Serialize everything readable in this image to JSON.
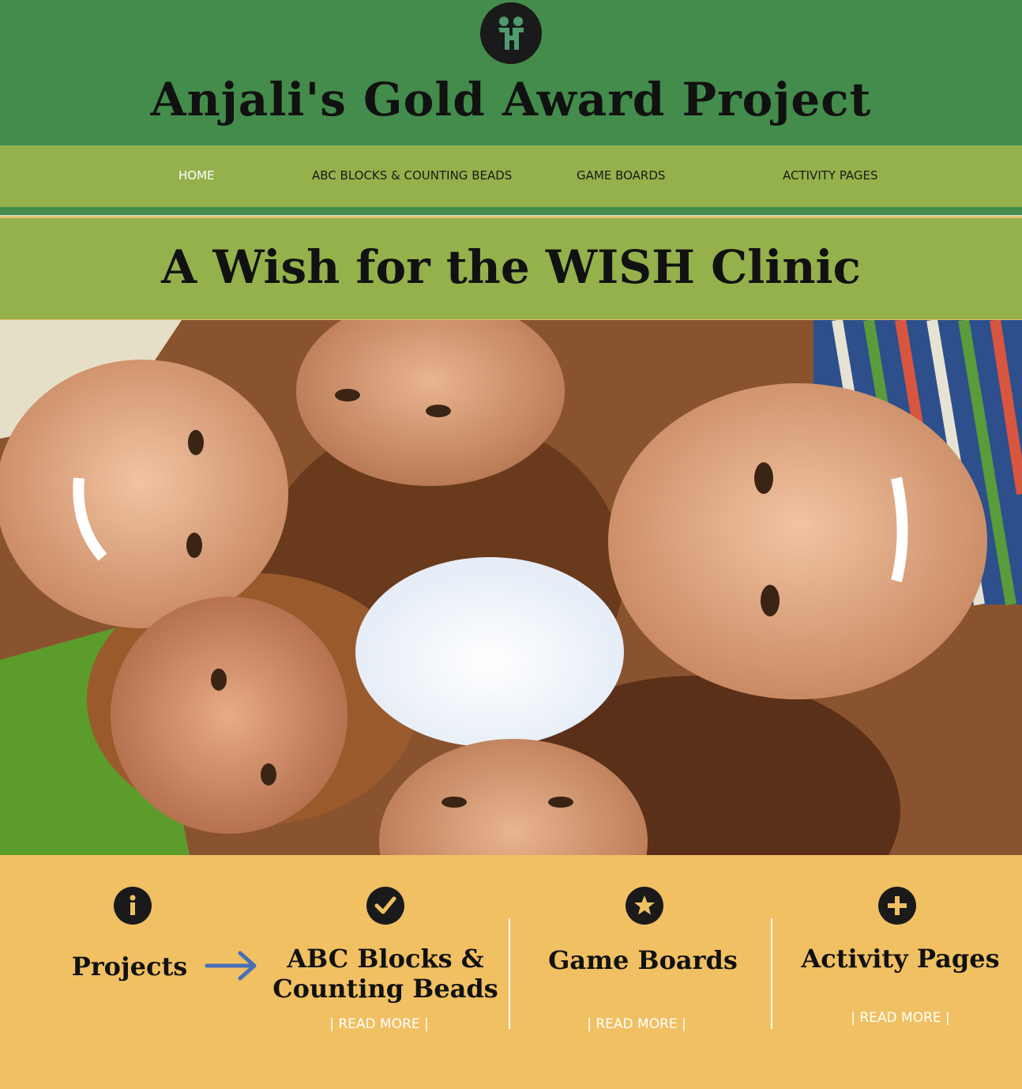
{
  "header": {
    "title": "Anjali's Gold Award Project",
    "logo_icon": "family-logo-icon"
  },
  "nav": {
    "items": [
      {
        "label": "HOME",
        "active": true
      },
      {
        "label": "ABC BLOCKS & COUNTING BEADS",
        "active": false
      },
      {
        "label": "GAME BOARDS",
        "active": false
      },
      {
        "label": "ACTIVITY PAGES",
        "active": false
      }
    ]
  },
  "banner": {
    "title": "A Wish for the WISH Clinic"
  },
  "hero": {
    "image": "photo-children-huddle"
  },
  "features": {
    "projects": {
      "title": "Projects",
      "icon": "info-icon"
    },
    "abc": {
      "title_line1": "ABC Blocks &",
      "title_line2": "Counting Beads",
      "icon": "check-icon",
      "read_more": "| READ MORE |"
    },
    "games": {
      "title": "Game Boards",
      "icon": "star-icon",
      "read_more": "| READ MORE |"
    },
    "activity": {
      "title": "Activity Pages",
      "icon": "plus-icon",
      "read_more": "| READ MORE |"
    },
    "arrow_icon": "arrow-right-icon"
  },
  "colors": {
    "header_green": "#438c4b",
    "nav_green": "#94b14b",
    "bottom_gold": "#f0c063",
    "arrow_blue": "#4a6fb5"
  }
}
